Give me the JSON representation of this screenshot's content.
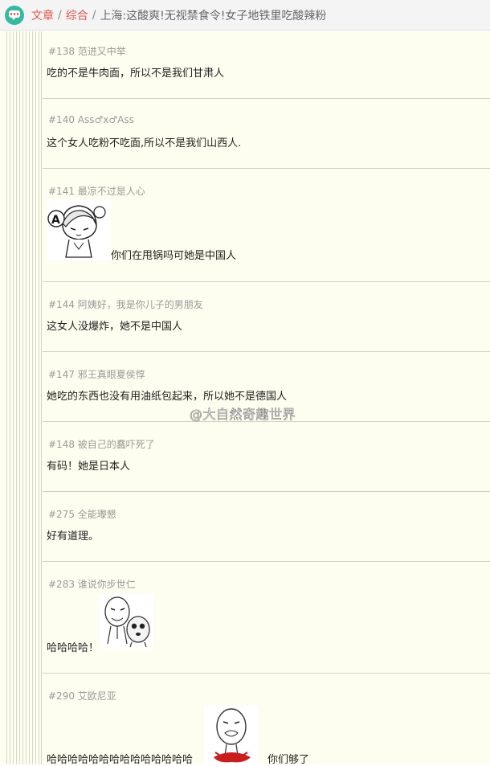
{
  "breadcrumb": {
    "section": "文章",
    "category": "综合",
    "separator": "/",
    "title": "上海:这酸爽!无视禁食令!女子地铁里吃酸辣粉"
  },
  "comments": [
    {
      "header": "#138 范进又中举",
      "body": "吃的不是牛肉面，所以不是我们甘肃人"
    },
    {
      "header": "#140 Ass♂x♂Ass",
      "body": "这个女人吃粉不吃面,所以不是我们山西人."
    },
    {
      "header": "#141 最凉不过是人心",
      "body": "你们在甩锅吗可她是中国人",
      "sticker": "anime-girl-sticker"
    },
    {
      "header": "#144 阿姨好，我是你儿子的男朋友",
      "body": "这女人没爆炸，她不是中国人"
    },
    {
      "header": "#147 邪王真眼夏侯惇",
      "body": "她吃的东西也没有用油纸包起来，所以她不是德国人"
    },
    {
      "header": "#148 被自己的蠢吓死了",
      "body": "有码！她是日本人"
    },
    {
      "header": "#275 全能瓈懇",
      "body": "好有道理。"
    },
    {
      "header": "#283 谁说你步世仁",
      "body": "哈哈哈哈！",
      "sticker": "panda-meme-sticker"
    },
    {
      "header": "#290 艾欧尼亚",
      "body": "哈哈哈哈哈哈哈哈哈哈哈哈哈哈",
      "body_after": "你们够了",
      "sticker": "rage-face-sticker"
    }
  ],
  "watermark": "@大自然奇趣世界",
  "colors": {
    "link": "#e2574c",
    "thread_bg": "#fefef0",
    "logo": "#35b9a3"
  }
}
